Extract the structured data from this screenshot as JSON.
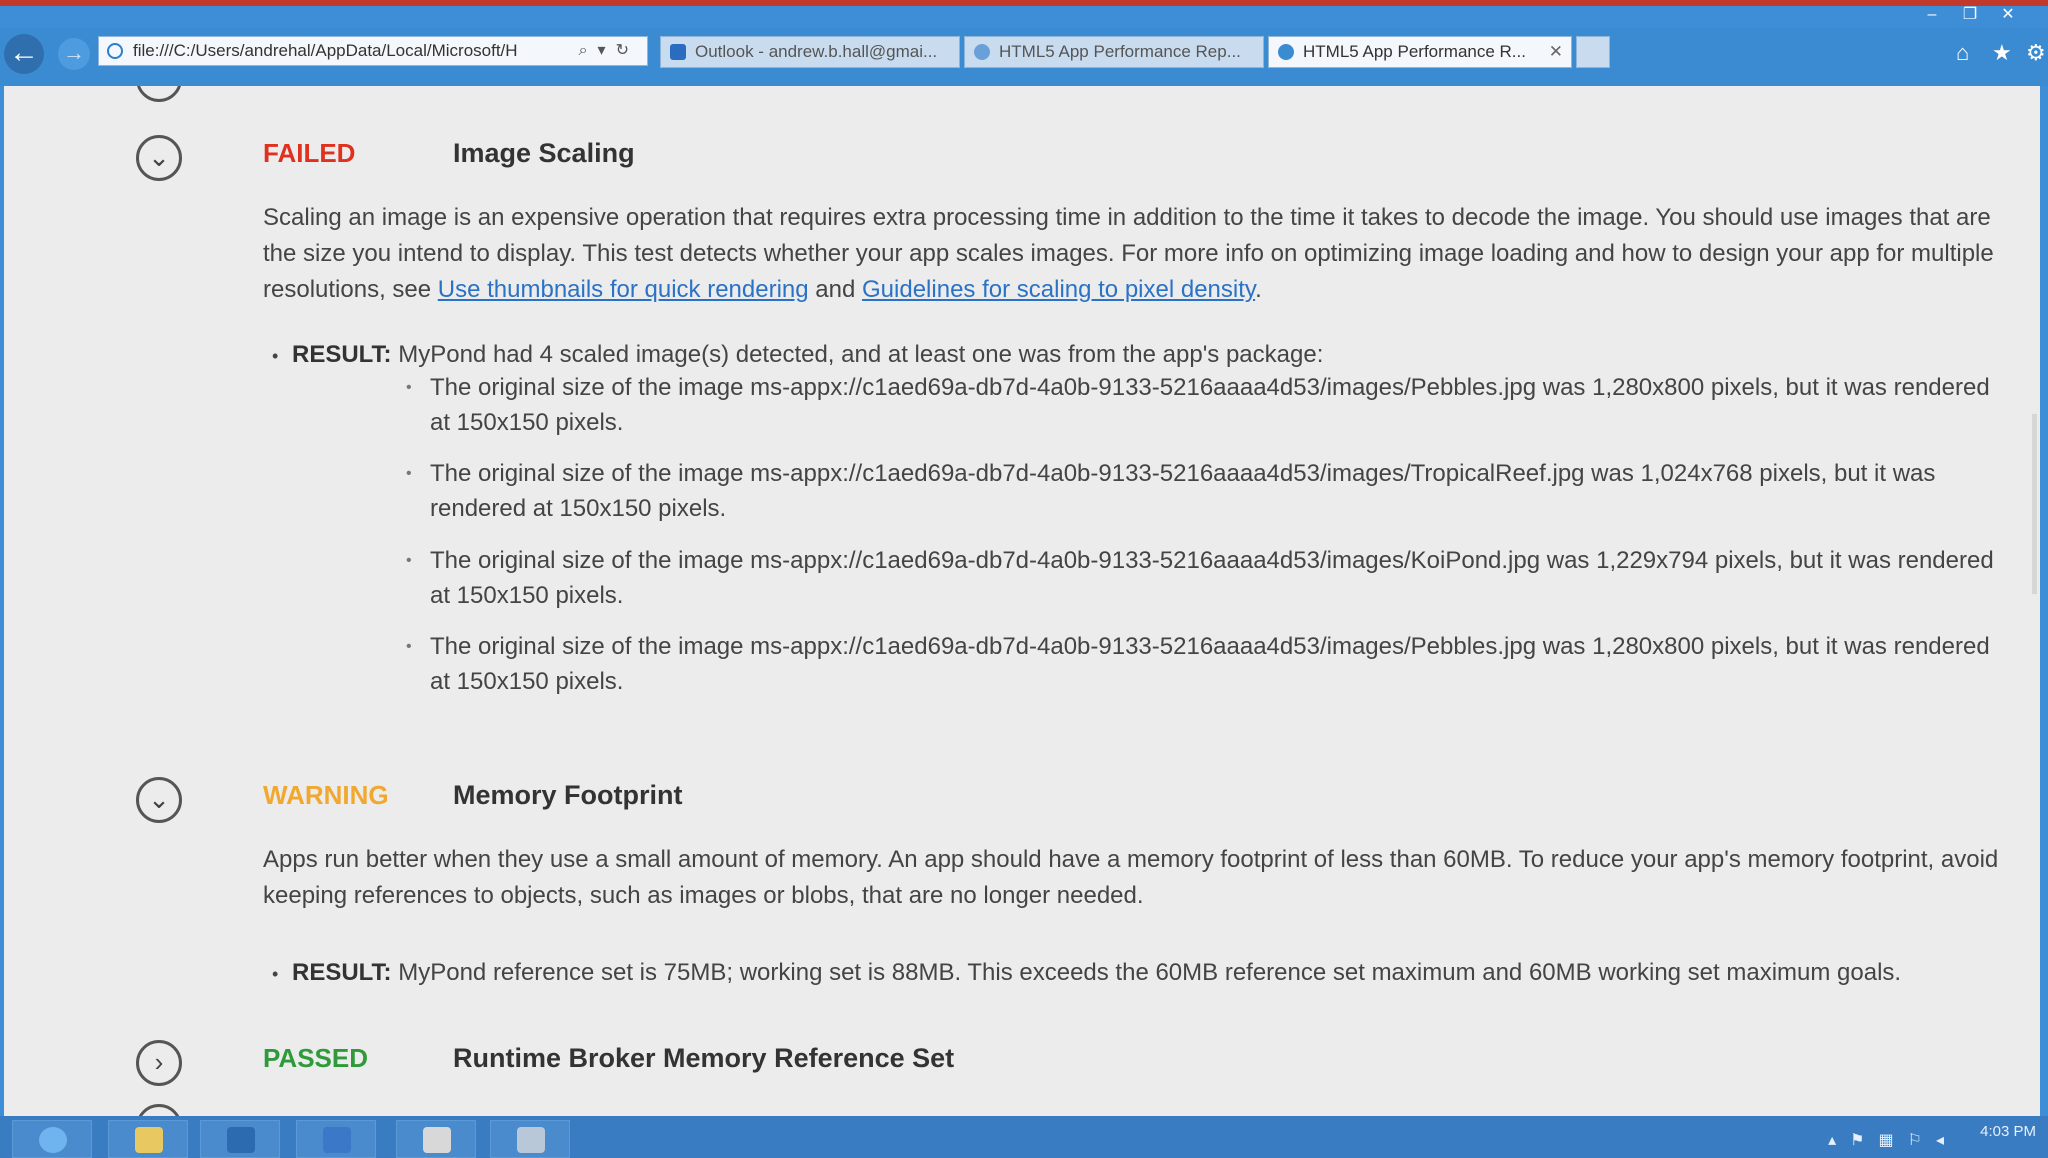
{
  "browser": {
    "address": "file:///C:/Users/andrehal/AppData/Local/Microsoft/H",
    "tabs": [
      {
        "label": "Outlook - andrew.b.hall@gmai..."
      },
      {
        "label": "HTML5 App Performance Rep..."
      },
      {
        "label": "HTML5 App Performance R..."
      }
    ]
  },
  "sections": [
    {
      "status": "FAILED",
      "status_color": "#e0301e",
      "toggle_icon": "chevron-down-icon",
      "title": "Image Scaling",
      "description": "Scaling an image is an expensive operation that requires extra processing time in addition to the time it takes to decode the image. You should use images that are the size you intend to display. This test detects whether your app scales images. For more info on optimizing image loading and how to design your app for multiple resolutions, see ",
      "link1": "Use thumbnails for quick rendering",
      "and_text": " and ",
      "link2": "Guidelines for scaling to pixel density",
      "period": ".",
      "result_label": "RESULT:",
      "result_text": " MyPond had 4 scaled image(s) detected, and at least one was from the app's package:",
      "details": [
        "The original size of the image ms-appx://c1aed69a-db7d-4a0b-9133-5216aaaa4d53/images/Pebbles.jpg was 1,280x800 pixels, but it was rendered at 150x150 pixels.",
        "The original size of the image ms-appx://c1aed69a-db7d-4a0b-9133-5216aaaa4d53/images/TropicalReef.jpg was 1,024x768 pixels, but it was rendered at 150x150 pixels.",
        "The original size of the image ms-appx://c1aed69a-db7d-4a0b-9133-5216aaaa4d53/images/KoiPond.jpg was 1,229x794 pixels, but it was rendered at 150x150 pixels.",
        "The original size of the image ms-appx://c1aed69a-db7d-4a0b-9133-5216aaaa4d53/images/Pebbles.jpg was 1,280x800 pixels, but it was rendered at 150x150 pixels."
      ]
    },
    {
      "status": "WARNING",
      "status_color": "#f0a830",
      "toggle_icon": "chevron-down-icon",
      "title": "Memory Footprint",
      "description": "Apps run better when they use a small amount of memory. An app should have a memory footprint of less than 60MB. To reduce your app's memory footprint, avoid keeping references to objects, such as images or blobs, that are no longer needed.",
      "result_label": "RESULT:",
      "result_text": " MyPond reference set is 75MB; working set is 88MB. This exceeds the 60MB reference set maximum and 60MB working set maximum goals."
    },
    {
      "status": "PASSED",
      "status_color": "#2e9a3a",
      "toggle_icon": "chevron-right-icon",
      "title": "Runtime Broker Memory Reference Set"
    }
  ],
  "taskbar": {
    "clock": "4:03 PM"
  }
}
